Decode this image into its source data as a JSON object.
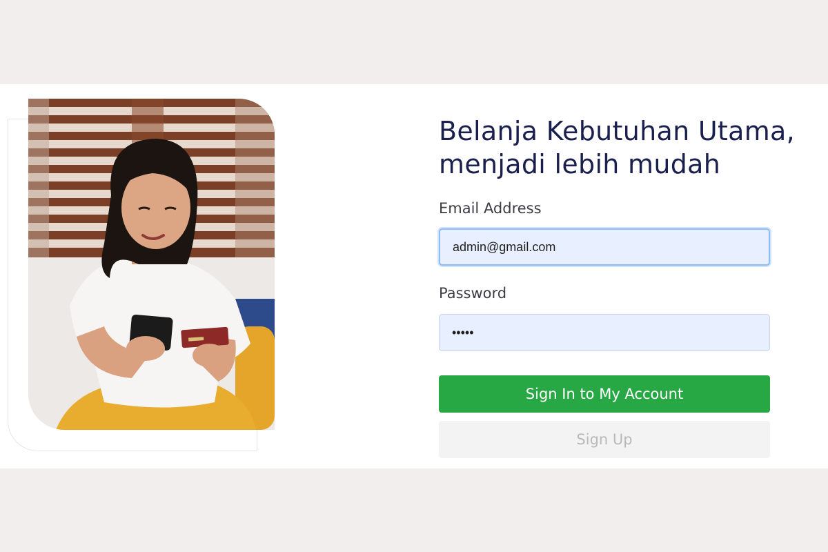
{
  "login": {
    "headline_line1": "Belanja Kebutuhan Utama,",
    "headline_line2": "menjadi lebih mudah",
    "email_label": "Email Address",
    "email_value": "admin@gmail.com",
    "password_label": "Password",
    "password_value": "•••••",
    "signin_label": "Sign In to My Account",
    "signup_label": "Sign Up"
  },
  "hero": {
    "description_icon": "woman-shopping-with-phone-and-card-photo"
  },
  "colors": {
    "background": "#f1eeed",
    "panel": "#ffffff",
    "headline": "#1a1f4d",
    "input_bg": "#e8effe",
    "primary_button": "#28a745",
    "secondary_button": "#f3f3f3"
  }
}
